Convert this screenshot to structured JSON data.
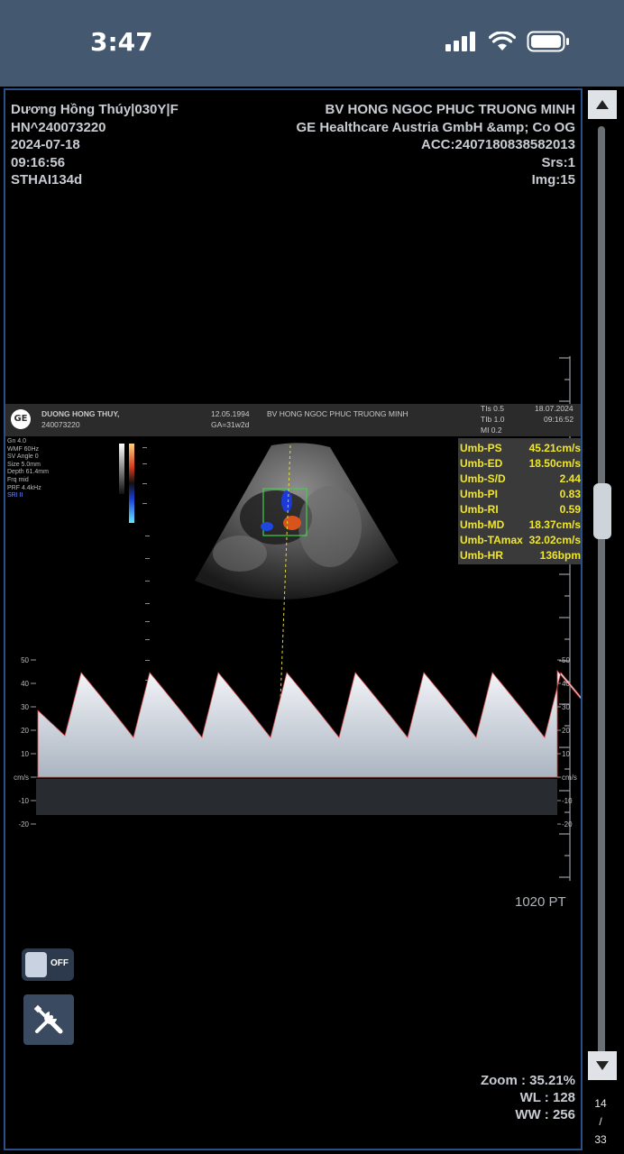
{
  "status_bar": {
    "time": "3:47"
  },
  "overlay": {
    "top_left": [
      "Dương Hồng Thúy|030Y|F",
      "HN^240073220",
      "2024-07-18",
      "09:16:56",
      "STHAI134d"
    ],
    "top_right": [
      "BV HONG NGOC PHUC TRUONG MINH",
      "GE Healthcare Austria GmbH &amp; Co OG",
      "ACC:2407180838582013",
      "Srs:1",
      "Img:15"
    ],
    "bottom_right": [
      "Zoom : 35.21%",
      "WL : 128",
      "WW : 256"
    ],
    "pt_label": "1020 PT"
  },
  "ultrasound": {
    "patient_name": "DUONG HONG THUY,",
    "patient_id": "240073220",
    "dob": "12.05.1994",
    "ga": "GA=31w2d",
    "hospital": "BV HONG NGOC PHUC TRUONG MINH",
    "tis": "TIs 0.5",
    "tib": "TIb 1.0",
    "mi": "MI 0.2",
    "date": "18.07.2024",
    "time": "09:16:52",
    "params": [
      "Gn 4.0",
      "WMF 60Hz",
      "SV Angle 0",
      "Size 5.0mm",
      "Depth 61.4mm",
      "Frq mid",
      "PRF 4.4kHz",
      "SRI II"
    ],
    "measurements": [
      {
        "label": "Umb-PS",
        "value": "45.21cm/s"
      },
      {
        "label": "Umb-ED",
        "value": "18.50cm/s"
      },
      {
        "label": "Umb-S/D",
        "value": "2.44"
      },
      {
        "label": "Umb-PI",
        "value": "0.83"
      },
      {
        "label": "Umb-RI",
        "value": "0.59"
      },
      {
        "label": "Umb-MD",
        "value": "18.37cm/s"
      },
      {
        "label": "Umb-TAmax",
        "value": "32.02cm/s"
      },
      {
        "label": "Umb-HR",
        "value": "136bpm"
      }
    ],
    "doppler_scale_left": [
      "50",
      "40",
      "30",
      "20",
      "10",
      "cm/s",
      "-10",
      "-20"
    ],
    "doppler_scale_right": [
      "50",
      "40",
      "30",
      "20",
      "10",
      "cm/s",
      "-10",
      "-20"
    ]
  },
  "controls": {
    "toggle_label": "OFF"
  },
  "pagination": {
    "current": "14",
    "separator": "/",
    "total": "33"
  }
}
